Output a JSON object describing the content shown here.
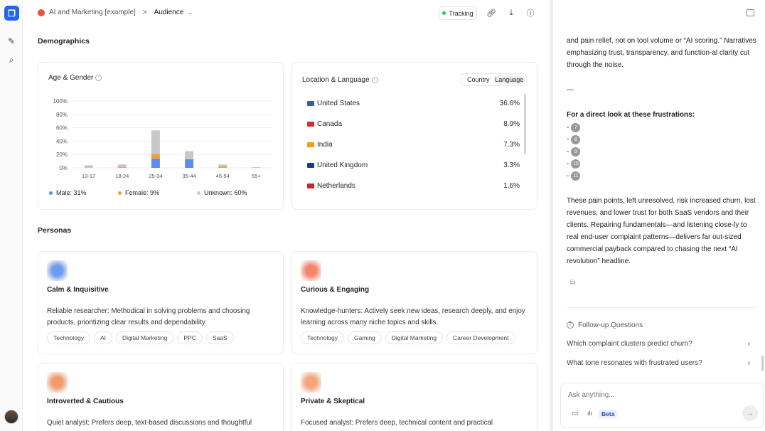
{
  "header": {
    "project": "AI and Marketing [example]",
    "separator": ">",
    "page": "Audience",
    "tracking_label": "Tracking"
  },
  "sections": {
    "demographics": "Demographics",
    "personas": "Personas"
  },
  "age_gender": {
    "title": "Age & Gender",
    "legend": [
      {
        "label": "Male: 31%",
        "color": "#5b8def"
      },
      {
        "label": "Female: 9%",
        "color": "#f0a030"
      },
      {
        "label": "Unknown: 60%",
        "color": "#c8c8c8"
      }
    ],
    "chart_data": {
      "type": "bar",
      "stacked": true,
      "categories": [
        "13-17",
        "18-24",
        "25-34",
        "35-44",
        "45-54",
        "55+"
      ],
      "y_ticks": [
        "0%",
        "20%",
        "40%",
        "60%",
        "80%",
        "100%"
      ],
      "ylim": [
        0,
        100
      ],
      "grid": true,
      "series": [
        {
          "name": "Male",
          "color": "#5b8def",
          "values": [
            0,
            0,
            14,
            13,
            0,
            0
          ]
        },
        {
          "name": "Female",
          "color": "#f0a030",
          "values": [
            0,
            1,
            7,
            0,
            2,
            0
          ]
        },
        {
          "name": "Unknown",
          "color": "#c8c8c8",
          "values": [
            4,
            4,
            35,
            12,
            3,
            1
          ]
        }
      ]
    }
  },
  "location": {
    "title": "Location & Language",
    "toggle": [
      "Country",
      "Language"
    ],
    "rows": [
      {
        "name": "United States",
        "pct": "36.6%",
        "flag": "#3b5ba8"
      },
      {
        "name": "Canada",
        "pct": "8.9%",
        "flag": "#d32f2f"
      },
      {
        "name": "India",
        "pct": "7.3%",
        "flag": "#f59e0b"
      },
      {
        "name": "United Kingdom",
        "pct": "3.3%",
        "flag": "#1e3a8a"
      },
      {
        "name": "Netherlands",
        "pct": "1.6%",
        "flag": "#c62828"
      }
    ]
  },
  "personas": [
    {
      "name": "Calm & Inquisitive",
      "desc": "Reliable researcher: Methodical in solving problems and choosing products, prioritizing clear results and dependability.",
      "tags": [
        "Technology",
        "AI",
        "Digital Marketing",
        "PPC",
        "SaaS"
      ],
      "color": "#6b9cf0"
    },
    {
      "name": "Curious & Engaging",
      "desc": "Knowledge-hunters: Actively seek new ideas, research deeply, and enjoy learning across many niche topics and skills.",
      "tags": [
        "Technology",
        "Gaming",
        "Digital Marketing",
        "Career Development"
      ],
      "color": "#f4876b"
    },
    {
      "name": "Introverted & Cautious",
      "desc": "Quiet analyst: Prefers deep, text-based discussions and thoughtful",
      "tags": [],
      "color": "#f39a6a"
    },
    {
      "name": "Private & Skeptical",
      "desc": "Focused analyst: Prefers deep, technical content and practical",
      "tags": [],
      "color": "#f7a37a"
    }
  ],
  "chat": {
    "para1": "and pain relief, not on tool volume or “AI scoring.” Narratives emphasizing trust, transparency, and function-al clarity cut through the noise.",
    "divider": "---",
    "heading": "For a direct look at these frustrations:",
    "refs": [
      "7",
      "8",
      "9",
      "10",
      "11"
    ],
    "para2": "These pain points, left unresolved, risk increased churn, lost revenues, and lower trust for both SaaS vendors and their clients. Repairing fundamentals—and listening close-ly to real end-user complaint patterns—delivers far out-sized commercial payback compared to chasing the next “AI revolution” headline.",
    "followup_title": "Follow-up Questions",
    "followups": [
      "Which complaint clusters predict churn?",
      "What tone resonates with frustrated users?"
    ],
    "ask_placeholder": "Ask anything...",
    "beta": "Beta"
  }
}
